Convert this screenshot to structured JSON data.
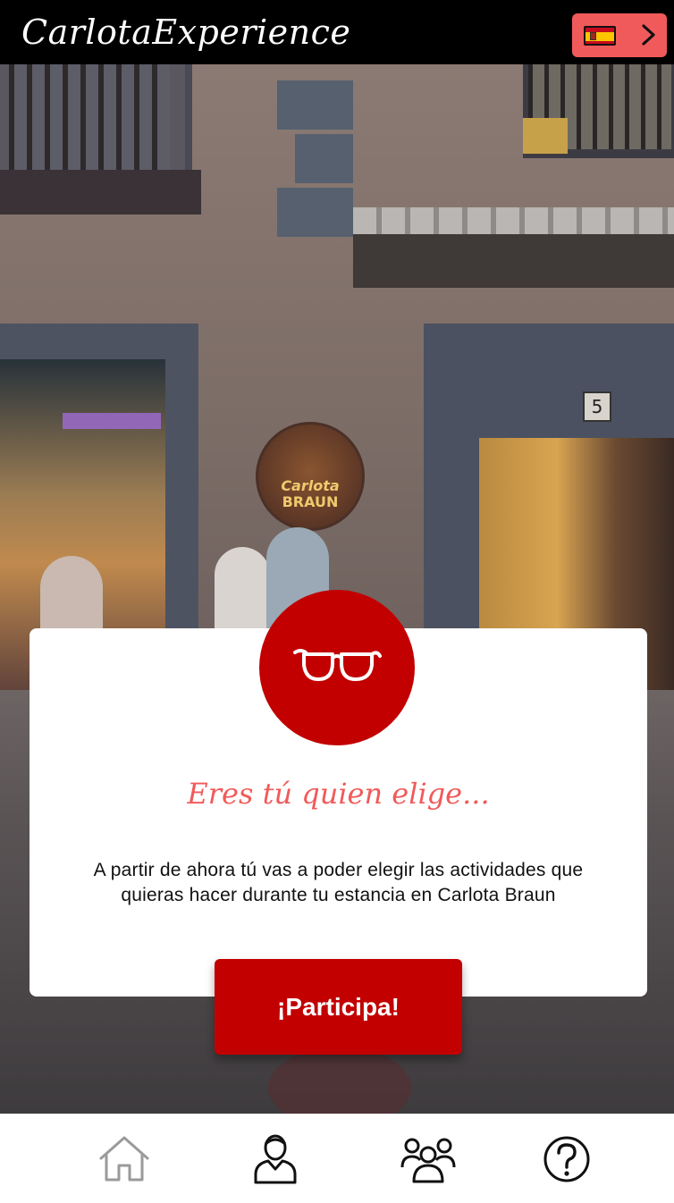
{
  "header": {
    "brand": "CarlotaExperience",
    "language_flag_icon": "spain-flag-icon",
    "language_chevron_icon": "chevron-right-icon",
    "accent_color": "#f15a5a"
  },
  "hero": {
    "sign_text_line1": "Carlota",
    "sign_text_line2": "BRAUN",
    "door_number": "5"
  },
  "card": {
    "icon": "glasses-icon",
    "title": "Eres tú quien elige...",
    "body": "A partir de ahora tú vas a poder elegir las actividades que quieras hacer durante tu estancia en Carlota Braun",
    "cta_label": "¡Participa!",
    "primary_color": "#c20000"
  },
  "bottom_nav": {
    "items": [
      {
        "icon": "home-icon",
        "active": true
      },
      {
        "icon": "user-icon",
        "active": false
      },
      {
        "icon": "group-icon",
        "active": false
      },
      {
        "icon": "help-icon",
        "active": false
      }
    ]
  }
}
